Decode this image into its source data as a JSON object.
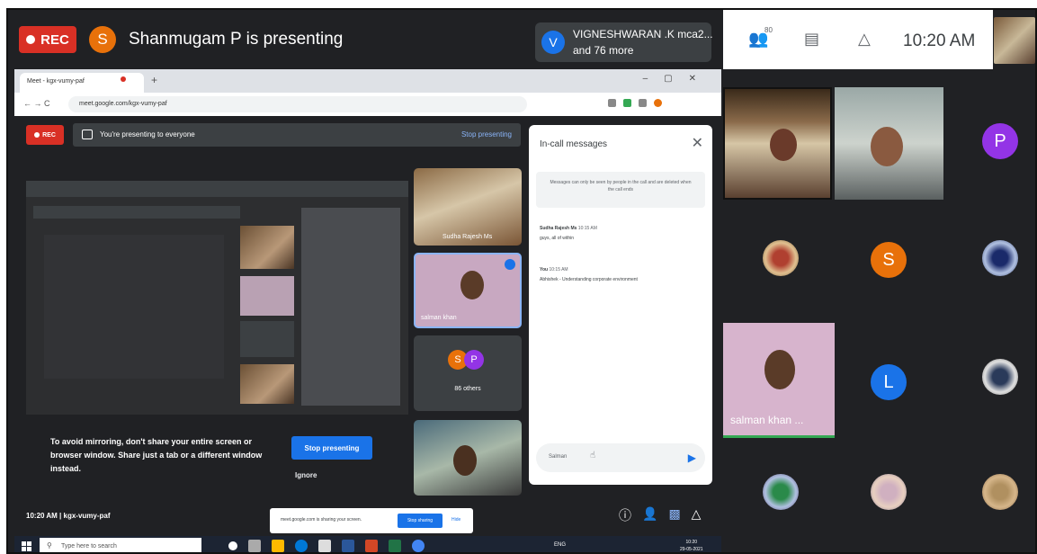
{
  "top_bar": {
    "rec_label": "REC",
    "presenter_initial": "S",
    "presenting_text": "Shanmugam P is presenting",
    "participants_initial": "V",
    "participants_line1": "VIGNESHWARAN .K mca2...",
    "participants_line2": "and 76 more",
    "people_badge": "80",
    "clock": "10:20 AM",
    "icons": [
      "people-icon",
      "chat-icon",
      "activities-icon"
    ]
  },
  "browser": {
    "tab_title": "Meet - kgx-vumy-paf",
    "url": "meet.google.com/kgx-vumy-paf"
  },
  "inner_meet": {
    "rec_label": "REC",
    "banner_text": "You're presenting to everyone",
    "banner_stop": "Stop presenting",
    "mirror_warning": "To avoid mirroring, don't share your entire screen or browser window. Share just a tab or a different window instead.",
    "stop_button": "Stop presenting",
    "ignore_button": "Ignore",
    "tile1_label": "Sudha Rajesh Ms",
    "tile2_label": "salman khan",
    "others_initials": [
      "S",
      "P"
    ],
    "others_label": "86 others",
    "meeting_time": "10:20 AM  |  kgx-vumy-paf"
  },
  "messages": {
    "title": "In-call messages",
    "note": "Messages can only be seen by people in the call and are deleted when the call ends",
    "items": [
      {
        "sender": "Sudha Rajesh Ms",
        "time": "10:15 AM",
        "text": "guys, all of within"
      },
      {
        "sender": "You",
        "time": "10:15 AM",
        "text": "Abhishek - Understanding corporate environment"
      }
    ],
    "input_value": "Salman"
  },
  "share_notice": {
    "text": "meet.google.com is sharing your screen.",
    "stop": "Stop sharing",
    "hide": "Hide"
  },
  "taskbar": {
    "search_placeholder": "Type here to search",
    "tray": "ENG",
    "time": "10:20",
    "date": "29-05-2021"
  },
  "grid": {
    "p_initial": "P",
    "s_initial": "S",
    "l_initial": "L",
    "salman_label": "salman khan ..."
  },
  "colors": {
    "rec": "#d93025",
    "accent": "#1a73e8",
    "orange": "#e8710a",
    "purple": "#9334e6",
    "speaking": "#34a853"
  }
}
